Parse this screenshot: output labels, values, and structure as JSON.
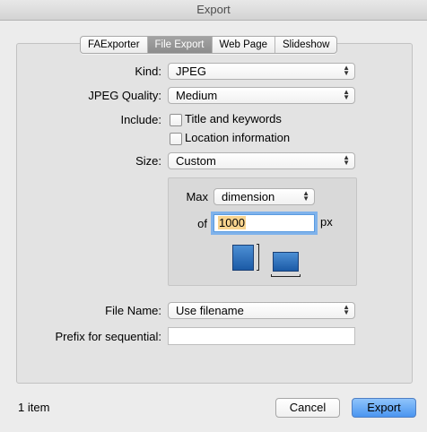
{
  "window": {
    "title": "Export"
  },
  "tabs": [
    {
      "label": "FAExporter"
    },
    {
      "label": "File Export"
    },
    {
      "label": "Web Page"
    },
    {
      "label": "Slideshow"
    }
  ],
  "active_tab": "File Export",
  "form": {
    "kind_label": "Kind:",
    "kind_value": "JPEG",
    "quality_label": "JPEG Quality:",
    "quality_value": "Medium",
    "include_label": "Include:",
    "include_title_label": "Title and keywords",
    "include_location_label": "Location information",
    "size_label": "Size:",
    "size_value": "Custom",
    "max_label": "Max",
    "max_value": "dimension",
    "of_label": "of",
    "of_value": "1000",
    "px_label": "px",
    "filename_label": "File Name:",
    "filename_value": "Use filename",
    "prefix_label": "Prefix for sequential:",
    "prefix_value": ""
  },
  "footer": {
    "status": "1 item",
    "cancel_label": "Cancel",
    "export_label": "Export"
  },
  "icons": {
    "portrait": "portrait-orientation-icon",
    "landscape": "landscape-orientation-icon"
  },
  "colors": {
    "accent": "#4a95f0",
    "selection": "#f8d48f"
  }
}
